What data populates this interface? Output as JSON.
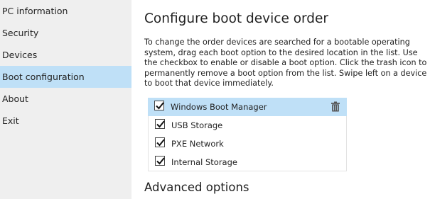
{
  "sidebar": {
    "items": [
      {
        "label": "PC information"
      },
      {
        "label": "Security"
      },
      {
        "label": "Devices"
      },
      {
        "label": "Boot configuration"
      },
      {
        "label": "About"
      },
      {
        "label": "Exit"
      }
    ],
    "active_index": 3
  },
  "main": {
    "title": "Configure boot device order",
    "description": "To change the order devices are searched for a bootable operating system, drag each boot option to the desired location in the list. Use the checkbox to enable or disable a boot option. Click the trash icon to permanently remove a boot option from the list. Swipe left on a device to boot that device immediately.",
    "boot_options": [
      {
        "label": "Windows Boot Manager",
        "checked": true
      },
      {
        "label": "USB Storage",
        "checked": true
      },
      {
        "label": "PXE Network",
        "checked": true
      },
      {
        "label": "Internal Storage",
        "checked": true
      }
    ],
    "advanced_title": "Advanced options"
  },
  "colors": {
    "sidebar_bg": "#efefef",
    "selection_bg": "#bfe0f7",
    "text": "#222222"
  },
  "icons": {
    "checkbox_checked": "check-icon",
    "delete": "trash-icon"
  }
}
